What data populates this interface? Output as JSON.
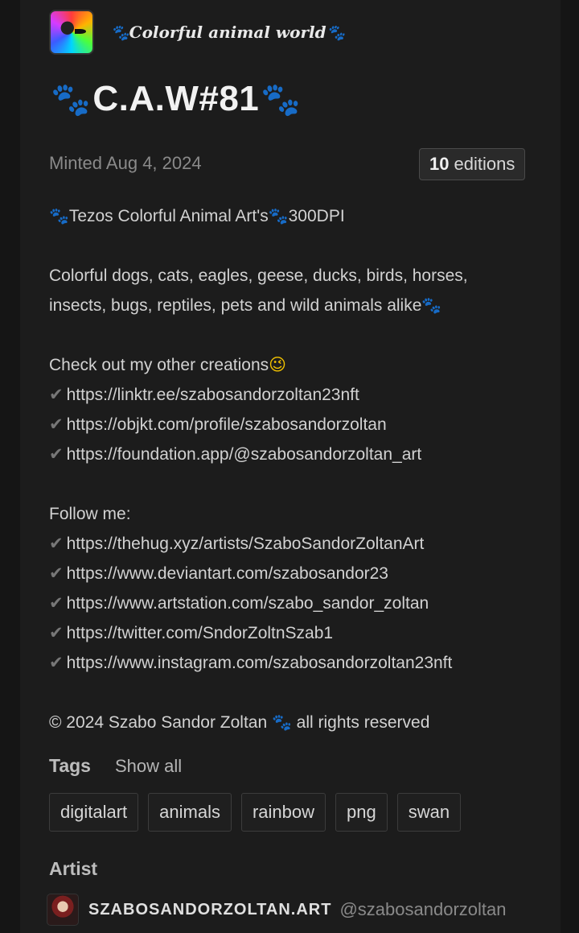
{
  "collection": {
    "name": "Colorful animal world"
  },
  "token": {
    "title": "C.A.W#81",
    "minted": "Minted Aug 4, 2024",
    "editions_count": "10",
    "editions_label": "editions"
  },
  "description": {
    "line1": "Tezos Colorful Animal Art's",
    "line1b": "300DPI",
    "line2": "Colorful dogs, cats, eagles, geese, ducks, birds, horses,",
    "line3": "insects, bugs, reptiles, pets and wild animals alike",
    "line4": "Check out my other creations",
    "links1": [
      "https://linktr.ee/szabosandorzoltan23nft",
      "https://objkt.com/profile/szabosandorzoltan",
      "https://foundation.app/@szabosandorzoltan_art"
    ],
    "follow": "Follow me:",
    "links2": [
      "https://thehug.xyz/artists/SzaboSandorZoltanArt",
      "https://www.deviantart.com/szabosandor23",
      "https://www.artstation.com/szabo_sandor_zoltan",
      "https://twitter.com/SndorZoltnSzab1",
      "https://www.instagram.com/szabosandorzoltan23nft"
    ],
    "copyright_a": "© 2024 Szabo Sandor Zoltan",
    "copyright_b": "all rights reserved"
  },
  "tags": {
    "label": "Tags",
    "show_all": "Show all",
    "items": [
      "digitalart",
      "animals",
      "rainbow",
      "png",
      "swan"
    ]
  },
  "artist": {
    "label": "Artist",
    "name": "SZABOSANDORZOLTAN.ART",
    "handle": "@szabosandorzoltan"
  },
  "icons": {
    "paw": "paw-icon",
    "check": "check-mark-icon",
    "wink": "wink-emoji-icon"
  }
}
